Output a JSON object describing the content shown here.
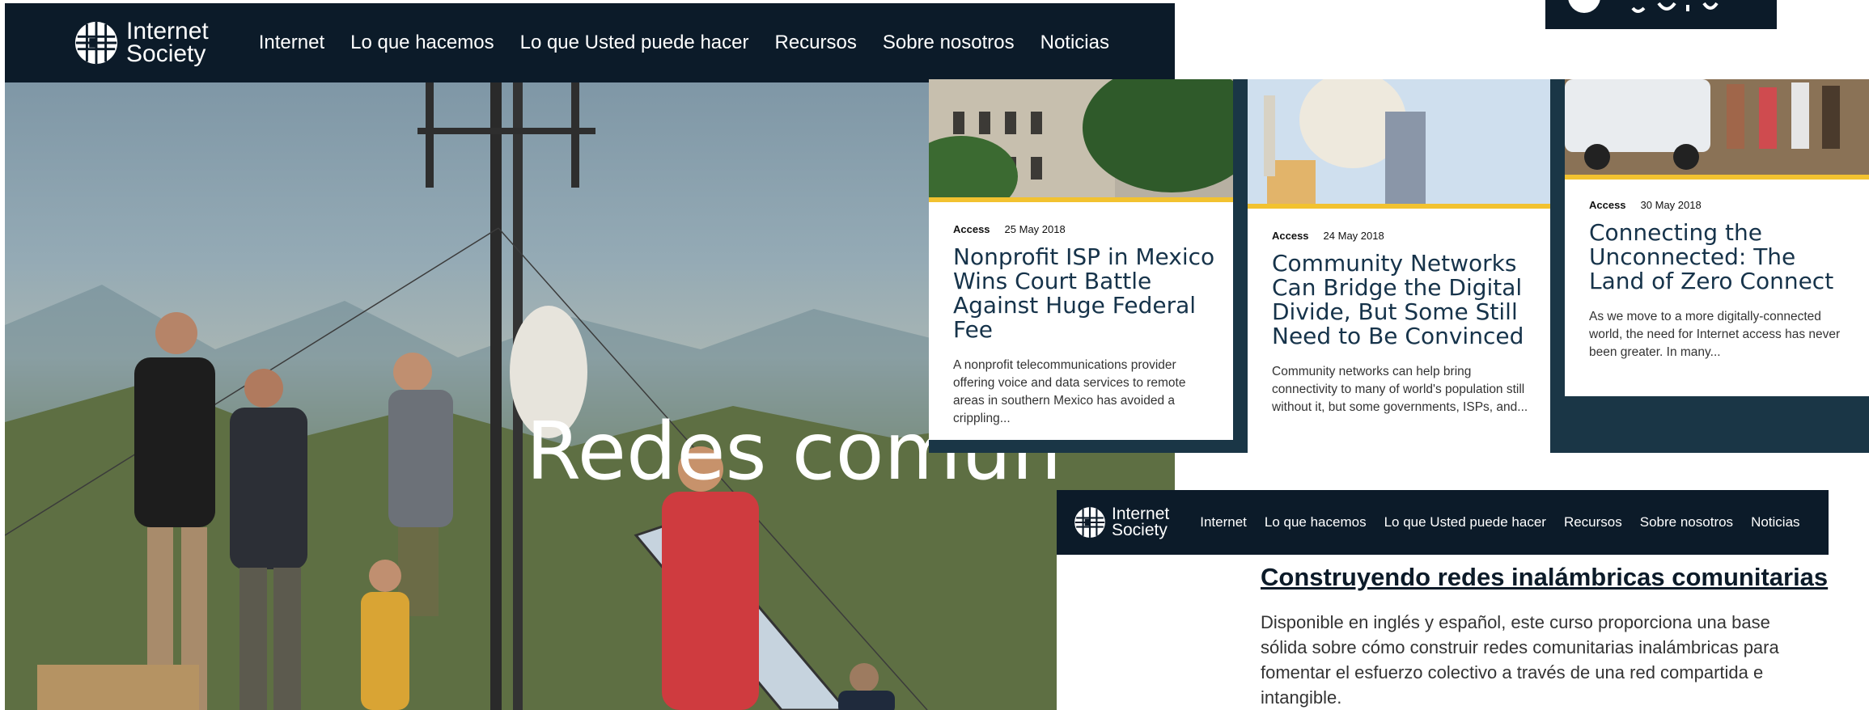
{
  "brand": {
    "logo_line1": "Internet",
    "logo_line2": "Society",
    "nav_color": "#0c1b29",
    "accent": "#f2c230"
  },
  "hero_nav": {
    "items": [
      "Internet",
      "Lo que hacemos",
      "Lo que Usted puede hacer",
      "Recursos",
      "Sobre nosotros",
      "Noticias"
    ]
  },
  "hero": {
    "title": "Redes comun"
  },
  "cards": [
    {
      "category": "Access",
      "date": "25 May 2018",
      "title": "Nonprofit ISP in Mexico Wins Court Battle Against Huge Federal Fee",
      "excerpt": "A nonprofit telecommunications provider offering voice and data services to remote areas in southern Mexico has avoided a crippling..."
    },
    {
      "category": "Access",
      "date": "24 May 2018",
      "title": "Community Networks Can Bridge the Digital Divide, But Some Still Need to Be Convinced",
      "excerpt": "Community networks can help bring connectivity to many of world's population still without it, but some governments, ISPs, and..."
    },
    {
      "category": "Access",
      "date": "30 May 2018",
      "title": "Connecting the Unconnected: The Land of Zero Connect",
      "excerpt": "As we move to a more digitally-connected world, the need for Internet access has never been greater. In many..."
    }
  ],
  "course_nav": {
    "items": [
      "Internet",
      "Lo que hacemos",
      "Lo que Usted puede hacer",
      "Recursos",
      "Sobre nosotros",
      "Noticias"
    ]
  },
  "course": {
    "title": "Construyendo redes inalámbricas comunitarias",
    "description": "Disponible en inglés y español, este curso proporciona una base sólida sobre cómo construir redes comunitarias inalámbricas para fomentar el esfuerzo colectivo a través de una red compartida e intangible."
  }
}
